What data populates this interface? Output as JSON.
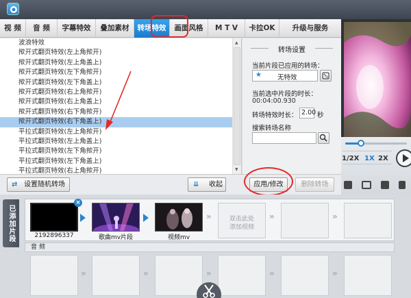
{
  "toolbar": {
    "tabs": [
      "视 频",
      "音 频",
      "字幕特效",
      "叠加素材",
      "转场特效",
      "画面风格",
      "M T V",
      "卡拉OK",
      "升级与服务"
    ],
    "active_index": 4
  },
  "transitions": {
    "items": [
      "波浪特效",
      "揿开式翻页特效(左上角揿开)",
      "揿开式翻页特效(左上角盖上)",
      "揿开式翻页特效(左下角揿开)",
      "揿开式翻页特效(左下角盖上)",
      "揿开式翻页特效(右上角揿开)",
      "揿开式翻页特效(右上角盖上)",
      "揿开式翻页特效(右下角揿开)",
      "揿开式翻页特效(右下角盖上)",
      "平拉式翻页特效(左上角揿开)",
      "平拉式翻页特效(左上角盖上)",
      "平拉式翻页特效(左下角揿开)",
      "平拉式翻页特效(左下角盖上)",
      "平拉式翻页特效(右上角揿开)"
    ],
    "selected_index": 8
  },
  "settings": {
    "title": "转场设置",
    "applied_label": "当前片段已应用的转场：",
    "applied_value": "无特效",
    "duration_label": "当前选中片段的时长：",
    "duration_value": "00:04:00.930",
    "effect_duration_label": "转场特效时长：",
    "effect_duration_value": "2.00",
    "effect_duration_unit": "秒",
    "search_label": "搜索转场名称",
    "search_value": ""
  },
  "actions": {
    "random": "设置随机转场",
    "collapse": "收起",
    "apply": "应用/修改",
    "delete": "删除转场"
  },
  "player": {
    "speeds": [
      "1/2X",
      "1X",
      "2X"
    ],
    "active_speed": "1X",
    "progress": 0.25
  },
  "timeline": {
    "side_label": "已添加片段",
    "clips": [
      {
        "name": "2192896337"
      },
      {
        "name": "歌曲mv片段"
      },
      {
        "name": "视频mv"
      }
    ],
    "placeholder": [
      "双击此处",
      "添加视频"
    ],
    "audio_label": "音 频"
  },
  "colors": {
    "accent": "#1a7ccc",
    "highlight": "#e52828",
    "selection": "#a9cdf0"
  }
}
